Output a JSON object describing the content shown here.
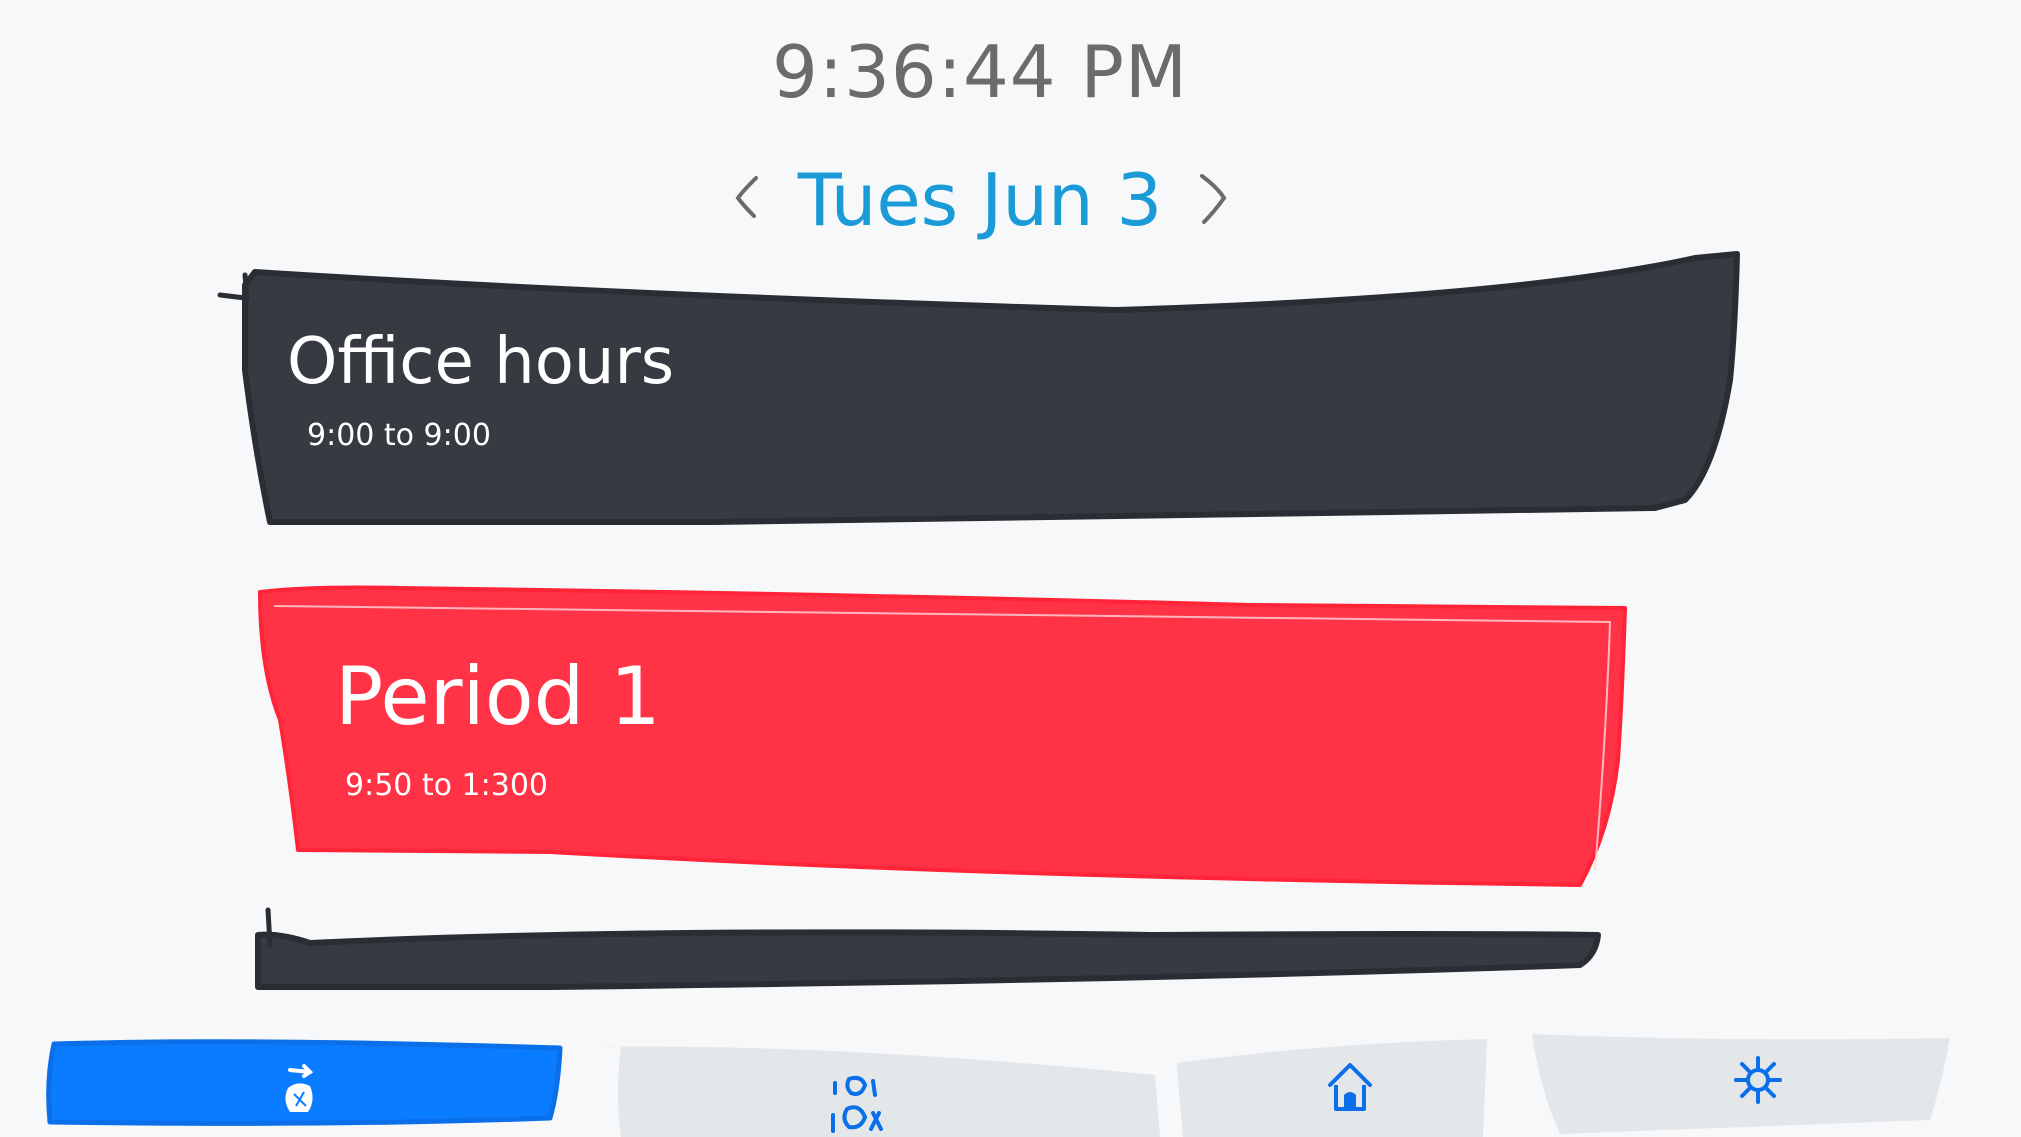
{
  "clock": {
    "time": "9:36:44 PM"
  },
  "date_nav": {
    "date": "Tues Jun 3",
    "prev_icon": "chevron-left-icon",
    "next_icon": "chevron-right-icon"
  },
  "schedule": [
    {
      "title": "Office hours",
      "time": "9:00 to 9:00",
      "color": "#363a41"
    },
    {
      "title": "Period 1",
      "time": "9:50 to 1:300",
      "color": "#ff3345"
    },
    {
      "title": "",
      "time": "",
      "color": "#363a41"
    }
  ],
  "tabbar": {
    "items": [
      {
        "icon": "schedule-icon",
        "active": true,
        "color": "#0a7cff"
      },
      {
        "icon": "classes-icon",
        "active": false,
        "color": "#e4e7ea"
      },
      {
        "icon": "home-icon",
        "active": false,
        "color": "#e4e7ea"
      },
      {
        "icon": "settings-icon",
        "active": false,
        "color": "#e4e7ea"
      }
    ]
  }
}
